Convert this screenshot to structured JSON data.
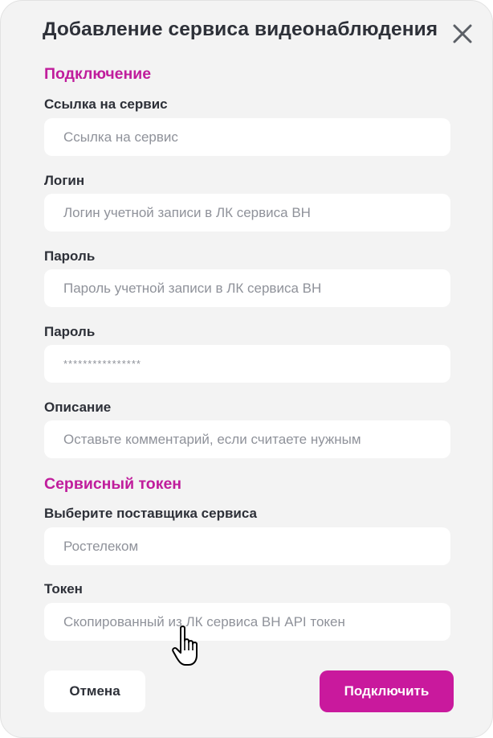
{
  "dialog": {
    "title": "Добавление сервиса видеонаблюдения",
    "close_icon": "close-icon"
  },
  "connection": {
    "section_title": "Подключение",
    "service_link": {
      "label": "Ссылка на сервис",
      "placeholder": "Ссылка на сервис",
      "value": ""
    },
    "login": {
      "label": "Логин",
      "placeholder": "Логин учетной записи в ЛК сервиса ВН",
      "value": ""
    },
    "password": {
      "label": "Пароль",
      "placeholder": "Пароль учетной записи в ЛК сервиса ВН",
      "value": ""
    },
    "password_confirm": {
      "label": "Пароль",
      "value": "****************"
    },
    "description": {
      "label": "Описание",
      "placeholder": "Оставьте комментарий, если считаете нужным",
      "value": ""
    }
  },
  "service_token": {
    "section_title": "Сервисный токен",
    "provider": {
      "label": "Выберите поставщика сервиса",
      "value": "Ростелеком"
    },
    "token": {
      "label": "Токен",
      "placeholder": "Скопированный из ЛК сервиса ВН API токен",
      "value": ""
    }
  },
  "actions": {
    "cancel_label": "Отмена",
    "connect_label": "Подключить"
  },
  "colors": {
    "accent": "#c9199d",
    "section_title": "#c01d9c",
    "dialog_background": "#f3f3f3",
    "text": "#2d3038",
    "placeholder": "#8f929a"
  },
  "cursor_icon": "hand-pointer-icon"
}
